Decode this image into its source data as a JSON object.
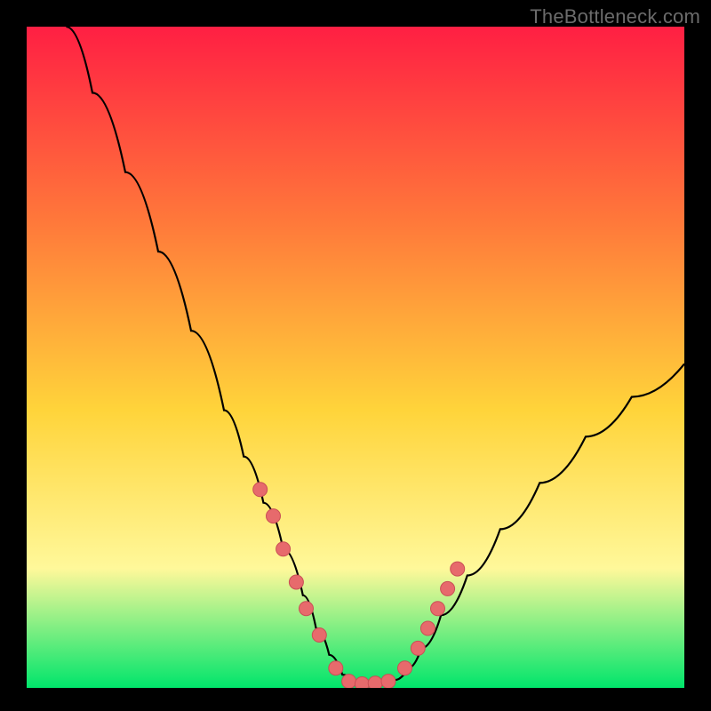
{
  "watermark": "TheBottleneck.com",
  "colors": {
    "frame": "#000000",
    "gradient_top": "#ff1f43",
    "gradient_mid_upper": "#ff7a3a",
    "gradient_mid": "#ffd43a",
    "gradient_low": "#fff89a",
    "gradient_bottom": "#00e56b",
    "curve": "#000000",
    "marker_fill": "#e76a6c",
    "marker_stroke": "#c94f55"
  },
  "chart_data": {
    "type": "line",
    "title": "",
    "xlabel": "",
    "ylabel": "",
    "xlim": [
      0,
      100
    ],
    "ylim": [
      0,
      100
    ],
    "grid": false,
    "legend": false,
    "series": [
      {
        "name": "bottleneck-curve",
        "x": [
          6,
          10,
          15,
          20,
          25,
          30,
          33,
          36,
          39,
          42,
          44,
          46,
          48,
          50,
          52,
          54,
          56,
          58,
          60,
          63,
          67,
          72,
          78,
          85,
          92,
          100
        ],
        "y": [
          100,
          90,
          78,
          66,
          54,
          42,
          35,
          28,
          21,
          14,
          9,
          5,
          2,
          0.8,
          0.5,
          0.6,
          1.2,
          3,
          6,
          11,
          17,
          24,
          31,
          38,
          44,
          49
        ]
      }
    ],
    "markers": {
      "name": "highlighted-configs",
      "x": [
        35.5,
        37.5,
        39,
        41,
        42.5,
        44.5,
        47,
        49,
        51,
        53,
        55,
        57.5,
        59.5,
        61,
        62.5,
        64,
        65.5
      ],
      "y": [
        30,
        26,
        21,
        16,
        12,
        8,
        3,
        1,
        0.6,
        0.7,
        1,
        3,
        6,
        9,
        12,
        15,
        18
      ]
    }
  }
}
